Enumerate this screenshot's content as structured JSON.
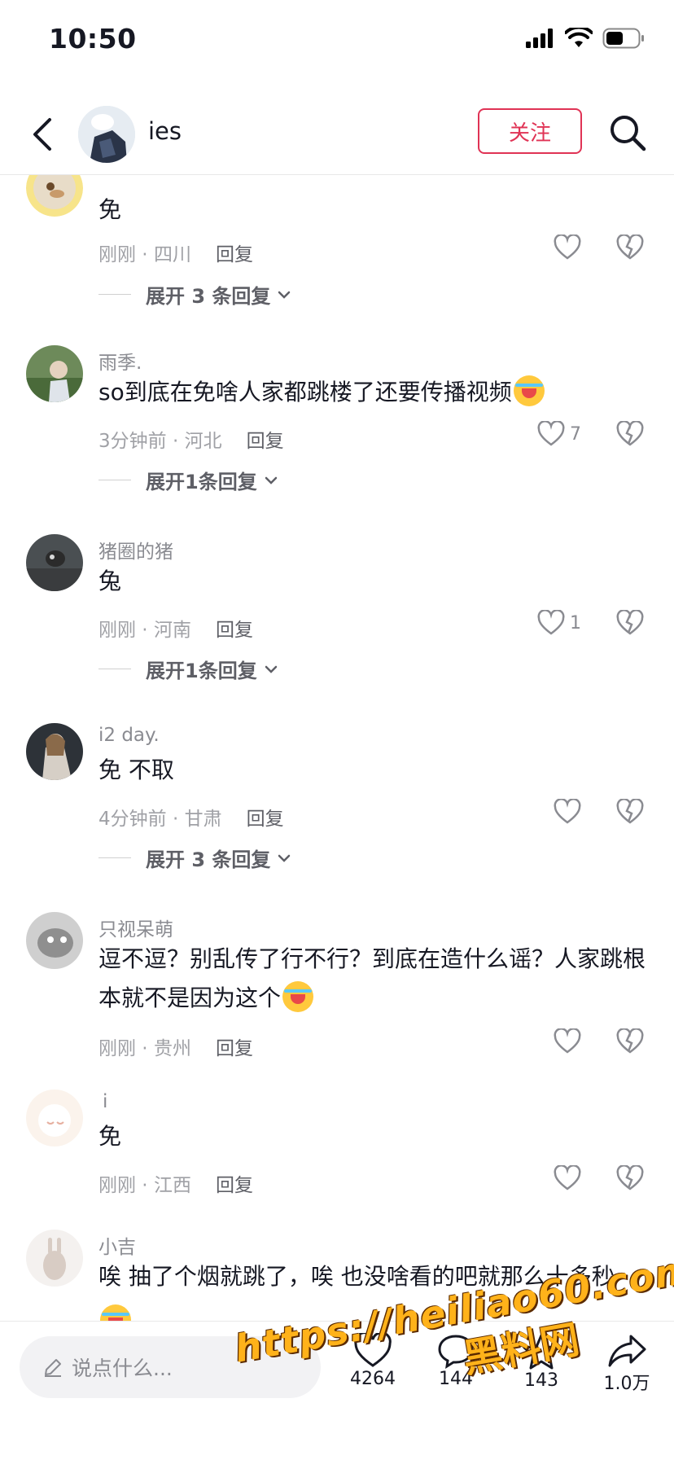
{
  "status_bar": {
    "time": "10:50"
  },
  "header": {
    "username": "ies",
    "follow_label": "关注"
  },
  "comments": [
    {
      "username": "",
      "text": "免",
      "time": "刚刚",
      "location": "四川",
      "reply_label": "回复",
      "likes": "",
      "expand_label": "展开 3 条回复"
    },
    {
      "username": "雨季.",
      "text": "so到底在免啥人家都跳楼了还要传播视频",
      "time": "3分钟前",
      "location": "河北",
      "reply_label": "回复",
      "likes": "7",
      "expand_label": "展开1条回复"
    },
    {
      "username": "猪圈的猪",
      "text": "兔",
      "time": "刚刚",
      "location": "河南",
      "reply_label": "回复",
      "likes": "1",
      "expand_label": "展开1条回复"
    },
    {
      "username": "i2 day.",
      "text": "免 不取",
      "time": "4分钟前",
      "location": "甘肃",
      "reply_label": "回复",
      "likes": "",
      "expand_label": "展开 3 条回复"
    },
    {
      "username": "只视呆萌",
      "text": "逗不逗？别乱传了行不行？到底在造什么谣？人家跳根本就不是因为这个",
      "time": "刚刚",
      "location": "贵州",
      "reply_label": "回复",
      "likes": "",
      "expand_label": ""
    },
    {
      "username": "i",
      "text": "免",
      "time": "刚刚",
      "location": "江西",
      "reply_label": "回复",
      "likes": "",
      "expand_label": ""
    },
    {
      "username": "小吉",
      "text": "唉 抽了个烟就跳了，唉 也没啥看的吧就那么十多秒",
      "time": "",
      "location": "",
      "reply_label": "",
      "likes": "",
      "expand_label": ""
    }
  ],
  "bottom_bar": {
    "input_placeholder": "说点什么...",
    "like_count": "4264",
    "comment_count": "144",
    "favorite_count": "143",
    "share_count": "1.0万"
  },
  "watermark": {
    "url": "https://heiliao60.com",
    "name": "黑料网"
  },
  "colors": {
    "accent": "#e03355",
    "watermark": "#ffb21a"
  }
}
